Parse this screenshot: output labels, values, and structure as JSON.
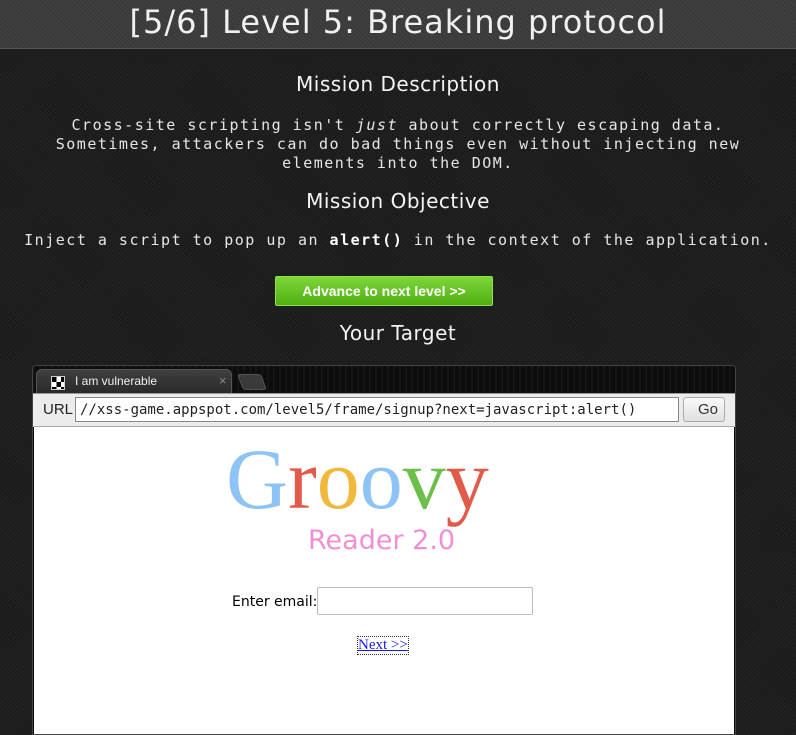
{
  "header": {
    "title": "[5/6]  Level 5: Breaking protocol"
  },
  "mission": {
    "description_title": "Mission Description",
    "description_pre": "Cross-site scripting isn't ",
    "description_em": "just",
    "description_post": " about correctly escaping data. Sometimes, attackers can do bad things even without injecting new elements into the DOM.",
    "objective_title": "Mission Objective",
    "objective_pre": "Inject a script to pop up an ",
    "objective_code": "alert()",
    "objective_post": " in the context of the application.",
    "advance_button": "Advance to next level >>",
    "target_title": "Your Target"
  },
  "browser": {
    "tab_title": "I am vulnerable",
    "tab_close": "×",
    "url_label": "URL",
    "url_value": "//xss-game.appspot.com/level5/frame/signup?next=javascript:alert()",
    "go_button": "Go"
  },
  "app": {
    "logo_letters": [
      {
        "char": "G",
        "color": "#8ec3f5"
      },
      {
        "char": "r",
        "color": "#e25a4a"
      },
      {
        "char": "o",
        "color": "#f0b93c"
      },
      {
        "char": "o",
        "color": "#8ec3f5"
      },
      {
        "char": "v",
        "color": "#6cc04a"
      },
      {
        "char": "y",
        "color": "#e25a4a"
      }
    ],
    "logo_subtitle": "Reader 2.0",
    "email_label": "Enter email:",
    "email_value": "",
    "next_link": "Next >>"
  }
}
